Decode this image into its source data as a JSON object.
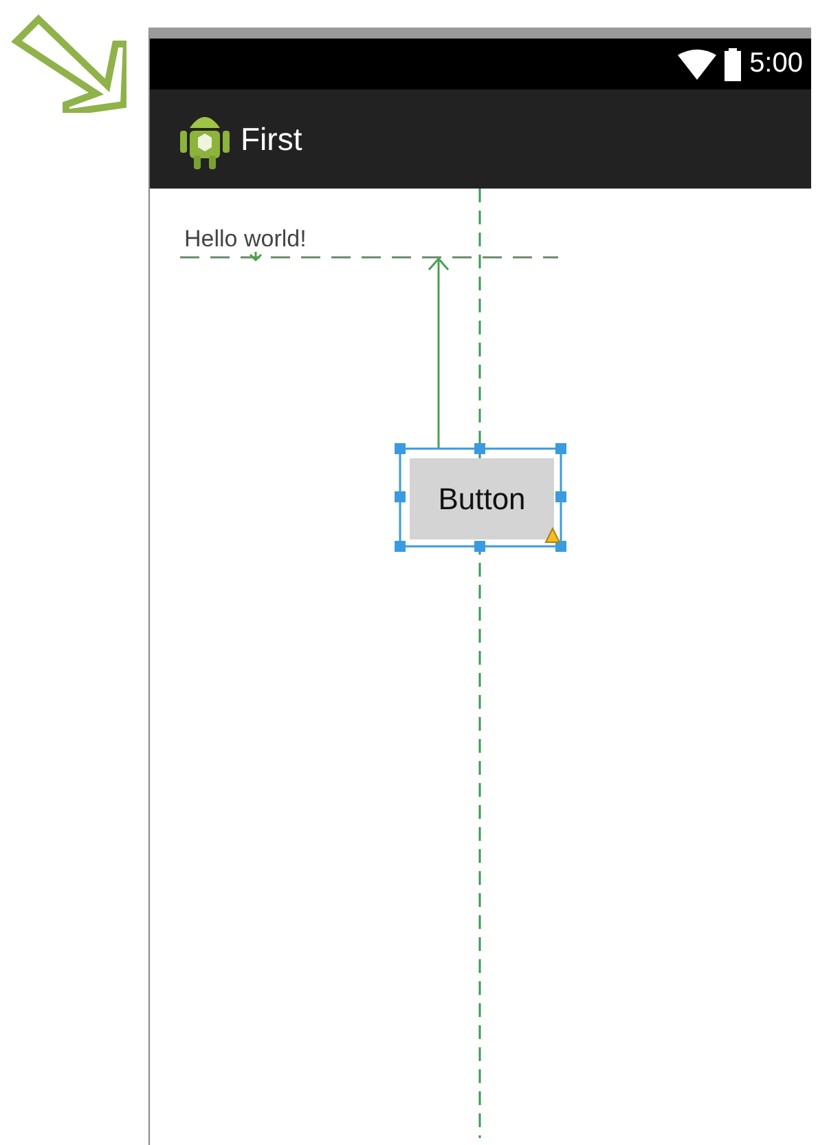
{
  "status_bar": {
    "time": "5:00"
  },
  "action_bar": {
    "title": "First"
  },
  "canvas": {
    "text_view": {
      "text": "Hello world!"
    },
    "button": {
      "label": "Button",
      "selected": true,
      "warning": true
    }
  }
}
